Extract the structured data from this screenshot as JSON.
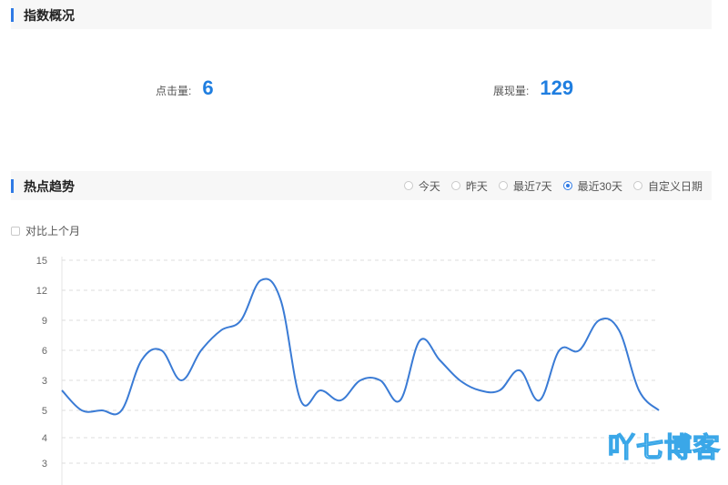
{
  "overview": {
    "title": "指数概况",
    "clicks_label": "点击量:",
    "clicks_value": "6",
    "views_label": "展现量:",
    "views_value": "129"
  },
  "trend": {
    "title": "热点趋势",
    "ranges": [
      {
        "label": "今天",
        "selected": false
      },
      {
        "label": "昨天",
        "selected": false
      },
      {
        "label": "最近7天",
        "selected": false
      },
      {
        "label": "最近30天",
        "selected": true
      },
      {
        "label": "自定义日期",
        "selected": false
      }
    ],
    "compare_label": "对比上个月"
  },
  "watermark": "吖七博客",
  "colors": {
    "line": "#3a7bd5",
    "accent": "#1f7ee0",
    "header_bar": "#2f7ae5"
  },
  "chart_data": {
    "type": "line",
    "title": "",
    "xlabel": "",
    "ylabel": "",
    "ylim": [
      0,
      15
    ],
    "yticks": [
      15,
      12,
      9,
      6,
      3,
      5,
      4,
      3
    ],
    "grid": true,
    "series": [
      {
        "values": [
          2,
          0,
          0,
          0,
          5,
          6,
          3,
          6,
          8,
          9,
          13,
          11,
          1,
          2,
          1,
          3,
          3,
          1,
          7,
          5,
          3,
          2,
          2,
          4,
          1,
          6,
          6,
          9,
          8,
          2,
          0
        ]
      }
    ]
  }
}
